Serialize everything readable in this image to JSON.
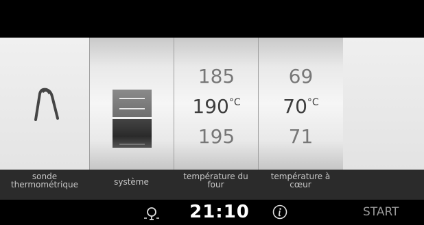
{
  "icons": {
    "probe": "thermometer-probe-icon",
    "system": "system-layers-icon",
    "light": "light-bulb-icon",
    "info": "info-icon"
  },
  "oven_temperature": {
    "prev": "185",
    "current": "190",
    "next": "195",
    "unit": "°C"
  },
  "core_temperature": {
    "prev": "69",
    "current": "70",
    "next": "71",
    "unit": "°C"
  },
  "labels": {
    "probe_line1": "sonde",
    "probe_line2": "thermométrique",
    "system": "système",
    "oven_line1": "température du",
    "oven_line2": "four",
    "core_line1": "température à",
    "core_line2": "cœur"
  },
  "bottom": {
    "time": "21:10",
    "start": "START"
  }
}
